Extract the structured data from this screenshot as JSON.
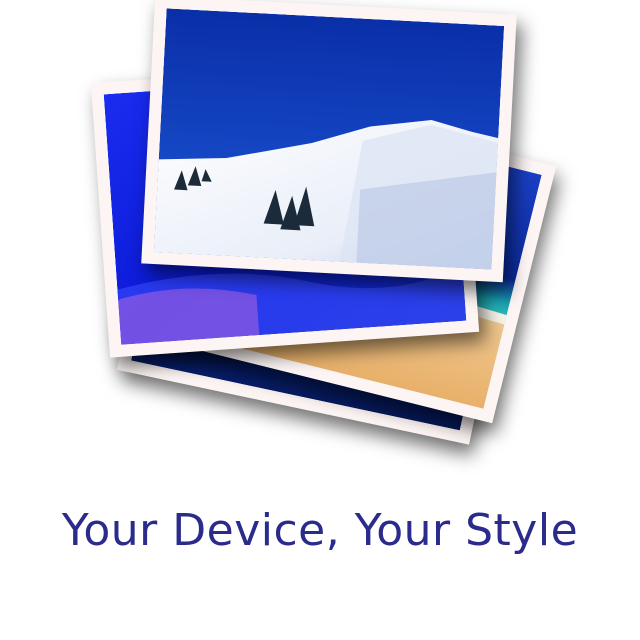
{
  "tagline": "Your Device, Your Style",
  "colors": {
    "tagline": "#2b2b8c",
    "sky": "#0b33b8",
    "photo_border": "#fdf5f4"
  },
  "photos": [
    {
      "subject": "blue-abstract"
    },
    {
      "subject": "beach"
    },
    {
      "subject": "blue-wave"
    },
    {
      "subject": "snowy-mountain"
    }
  ]
}
